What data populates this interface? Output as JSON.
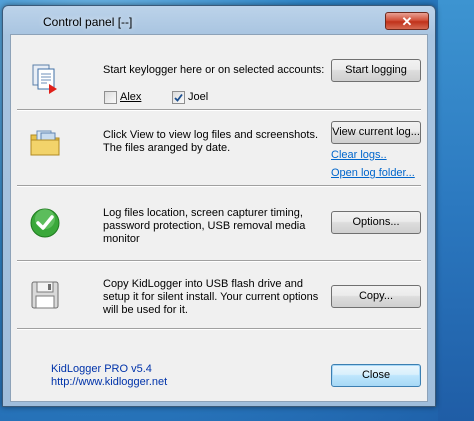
{
  "window": {
    "title": "Control panel  [--]",
    "close_glyph": "✕"
  },
  "logging": {
    "description": "Start keylogger here or on selected accounts:",
    "button": "Start logging",
    "accounts": [
      {
        "label": "Alex",
        "checked": false
      },
      {
        "label": "Joel",
        "checked": true
      }
    ],
    "icon": "document-play-icon"
  },
  "logs": {
    "description": "Click View to view log files and screenshots.\nThe files aranged by date.",
    "button": "View current log...",
    "clear_link": "Clear logs..",
    "open_link": "Open log folder...",
    "icon": "folder-icon"
  },
  "options": {
    "description": "Log files location, screen capturer timing,\npassword protection, USB removal media\nmonitor",
    "button": "Options...",
    "icon": "green-check-icon"
  },
  "copy": {
    "description": "Copy KidLogger into USB flash drive and\nsetup it for silent install. Your current options\nwill be used for it.",
    "button": "Copy...",
    "icon": "floppy-disk-icon"
  },
  "footer": {
    "product": "KidLogger PRO v5.4",
    "url": "http://www.kidlogger.net",
    "close_button": "Close"
  },
  "colors": {
    "link": "#0066cc",
    "client_bg": "#f0f0f0",
    "check_green": "#3aa83a"
  }
}
